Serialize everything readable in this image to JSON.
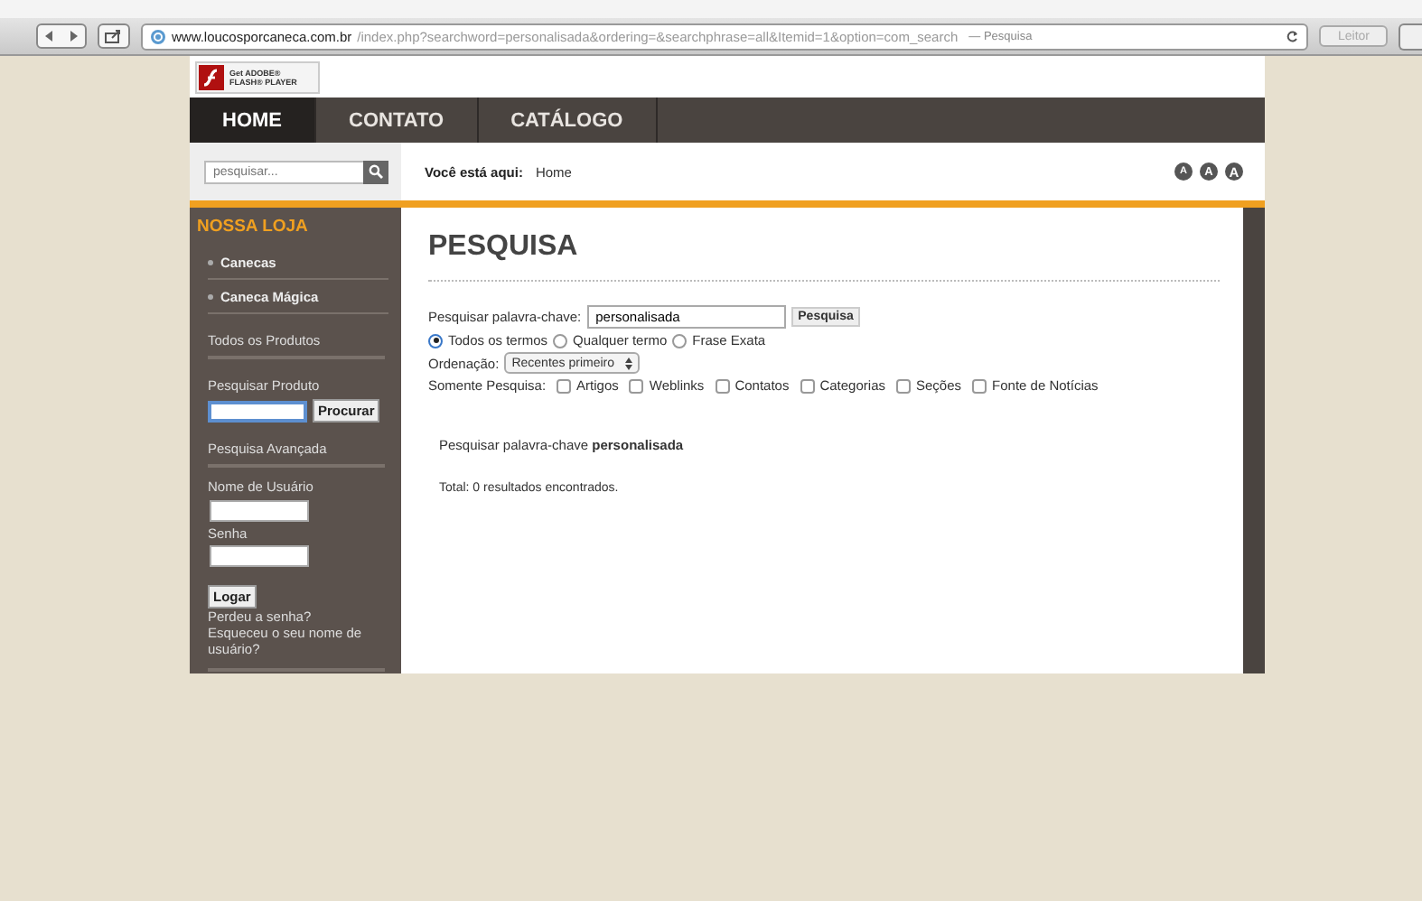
{
  "browser": {
    "url_host": "www.loucosporcaneca.com.br",
    "url_path": "/index.php?searchword=personalisada&ordering=&searchphrase=all&Itemid=1&option=com_search",
    "page_title": "— Pesquisa",
    "reader_button": "Leitor"
  },
  "flash_badge": {
    "line1": "Get ADOBE®",
    "line2": "FLASH® PLAYER"
  },
  "nav": [
    {
      "label": "HOME",
      "selected": true
    },
    {
      "label": "CONTATO",
      "selected": false
    },
    {
      "label": "CATÁLOGO",
      "selected": false
    }
  ],
  "search": {
    "placeholder": "pesquisar..."
  },
  "breadcrumb": {
    "label": "Você está aqui:",
    "item": "Home"
  },
  "font_size_buttons": [
    "A",
    "A",
    "A"
  ],
  "sidebar": {
    "heading": "NOSSA LOJA",
    "categories": [
      "Canecas",
      "Caneca Mágica"
    ],
    "all_products": "Todos os Produtos",
    "product_search_label": "Pesquisar Produto",
    "product_search_button": "Procurar",
    "advanced_search": "Pesquisa Avançada",
    "username_label": "Nome de Usuário",
    "password_label": "Senha",
    "login_button": "Logar",
    "login_links": [
      "Perdeu a senha?",
      "Esqueceu o seu nome de usuário?"
    ]
  },
  "content": {
    "title": "PESQUISA",
    "keyword_label": "Pesquisar palavra-chave:",
    "keyword_value": "personalisada",
    "submit": "Pesquisa",
    "radios": [
      {
        "label": "Todos os termos",
        "selected": true
      },
      {
        "label": "Qualquer termo",
        "selected": false
      },
      {
        "label": "Frase Exata",
        "selected": false
      }
    ],
    "ordering_label": "Ordenação:",
    "ordering_value": "Recentes primeiro",
    "only_label": "Somente Pesquisa:",
    "checkboxes": [
      {
        "label": "Artigos",
        "checked": false
      },
      {
        "label": "Weblinks",
        "checked": false
      },
      {
        "label": "Contatos",
        "checked": false
      },
      {
        "label": "Categorias",
        "checked": false
      },
      {
        "label": "Seções",
        "checked": false
      },
      {
        "label": "Fonte de Notícias",
        "checked": false
      }
    ],
    "result_line": "Pesquisar palavra-chave **personalisada**",
    "total": "Total: 0 resultados encontrados."
  }
}
